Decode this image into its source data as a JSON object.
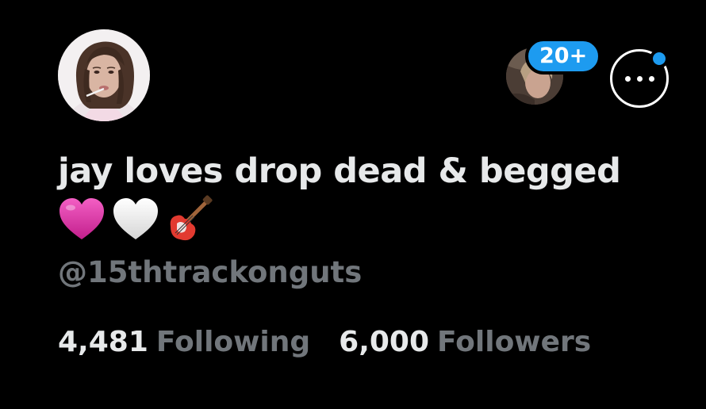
{
  "profile": {
    "display_name": "jay loves drop dead & begged",
    "name_emojis": [
      "pink-heart",
      "white-heart",
      "guitar"
    ],
    "handle": "@15thtrackonguts"
  },
  "header": {
    "notification_count": "20+"
  },
  "stats": {
    "following_count": "4,481",
    "following_label": "Following",
    "followers_count": "6,000",
    "followers_label": "Followers"
  },
  "colors": {
    "background": "#000000",
    "primary_text": "#e7e9ea",
    "secondary_text": "#71767b",
    "accent": "#1d9bf0",
    "pink_heart": "#e03aa8"
  }
}
